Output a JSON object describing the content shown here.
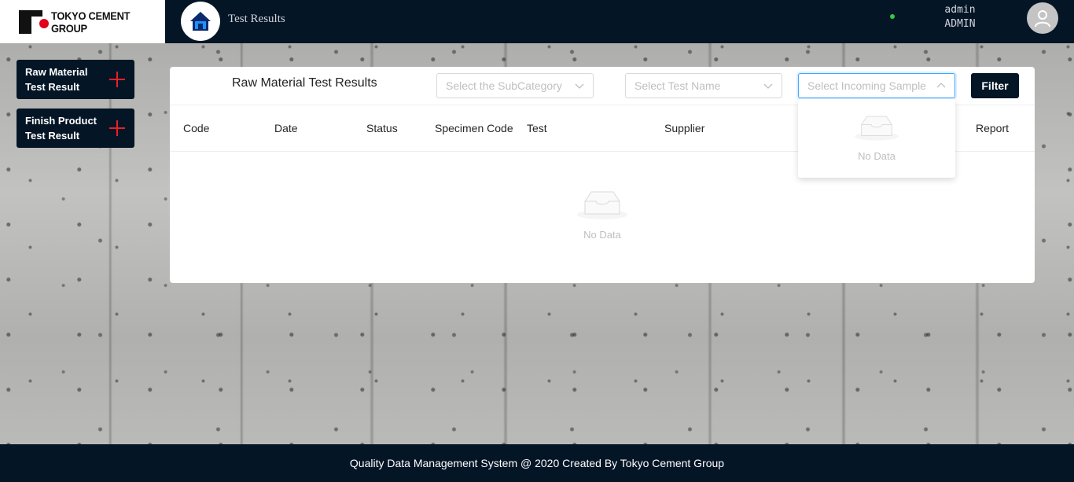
{
  "header": {
    "brand": "TOKYO CEMENT GROUP",
    "page_title": "Test Results",
    "user_name": "admin",
    "user_role": "ADMIN"
  },
  "sidebar": {
    "items": [
      {
        "label": "Raw Material Test Result"
      },
      {
        "label": "Finish Product Test Result"
      }
    ]
  },
  "main": {
    "title": "Raw Material Test Results",
    "filters": {
      "subcategory_placeholder": "Select the SubCategory",
      "test_name_placeholder": "Select Test Name",
      "incoming_sample_placeholder": "Select Incoming Sample",
      "filter_label": "Filter"
    },
    "table": {
      "columns": [
        "Code",
        "Date",
        "Status",
        "Specimen Code",
        "Test",
        "Supplier",
        "Report"
      ],
      "empty_text": "No Data"
    },
    "dropdown": {
      "empty_text": "No Data"
    }
  },
  "footer": {
    "text": "Quality Data Management System @ 2020 Created By Tokyo Cement Group"
  },
  "colors": {
    "navy": "#041526",
    "accent_red": "#e8202a",
    "online_green": "#2ecc40"
  }
}
